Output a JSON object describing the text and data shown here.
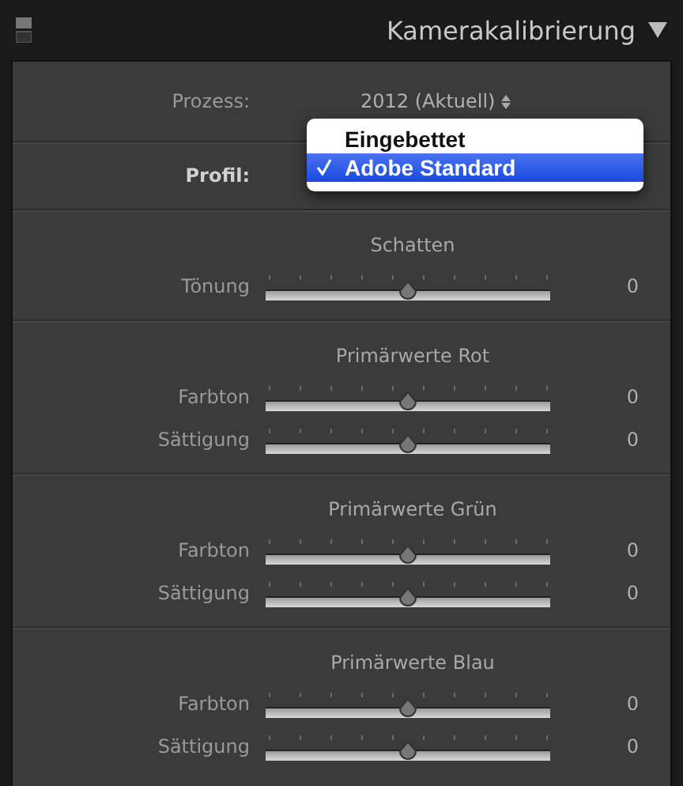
{
  "header": {
    "title": "Kamerakalibrierung"
  },
  "process": {
    "label": "Prozess:",
    "value": "2012 (Aktuell)"
  },
  "profile": {
    "label": "Profil:"
  },
  "menu": [
    {
      "label": "Eingebettet",
      "selected": false
    },
    {
      "label": "Adobe Standard",
      "selected": true
    }
  ],
  "sections": [
    {
      "title": "Schatten",
      "sliders": [
        {
          "label": "Tönung",
          "level": 0.5,
          "reading": "0"
        }
      ]
    },
    {
      "title": "Primärwerte Rot",
      "sliders": [
        {
          "label": "Farbton",
          "level": 0.5,
          "reading": "0"
        },
        {
          "label": "Sättigung",
          "level": 0.5,
          "reading": "0"
        }
      ]
    },
    {
      "title": "Primärwerte Grün",
      "sliders": [
        {
          "label": "Farbton",
          "level": 0.5,
          "reading": "0"
        },
        {
          "label": "Sättigung",
          "level": 0.5,
          "reading": "0"
        }
      ]
    },
    {
      "title": "Primärwerte Blau",
      "sliders": [
        {
          "label": "Farbton",
          "level": 0.5,
          "reading": "0"
        },
        {
          "label": "Sättigung",
          "level": 0.5,
          "reading": "0"
        }
      ]
    }
  ]
}
